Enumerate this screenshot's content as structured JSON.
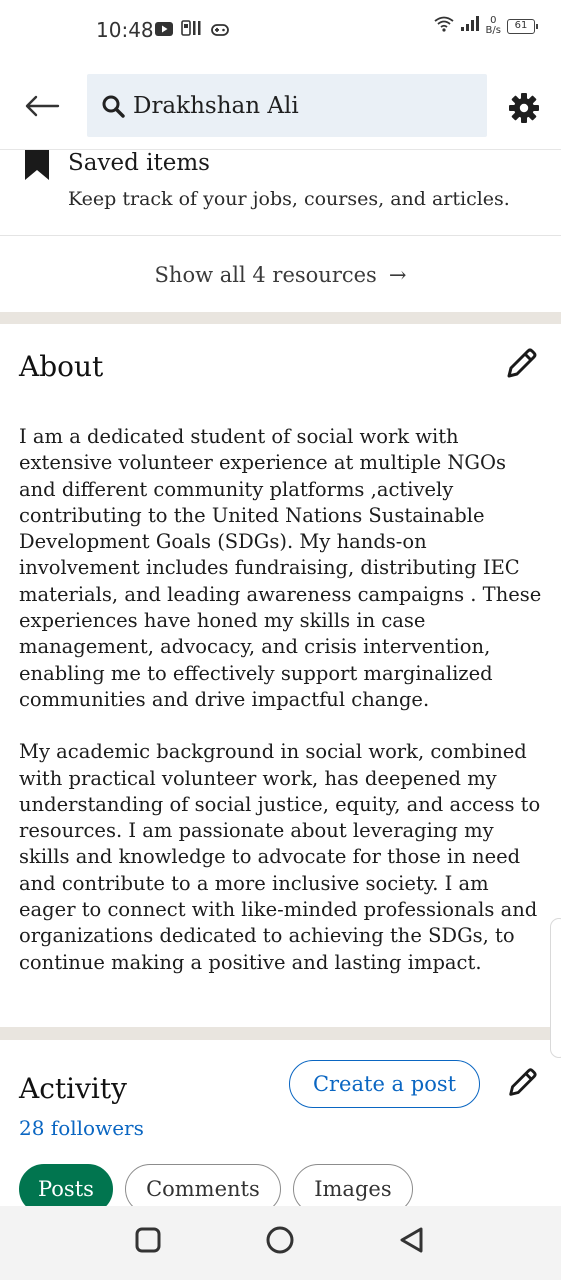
{
  "status_bar": {
    "time": "10:48",
    "net_speed_value": "0",
    "net_speed_unit": "B/s",
    "battery": "61"
  },
  "search": {
    "query": "Drakhshan Ali"
  },
  "saved": {
    "title": "Saved items",
    "description": "Keep track of your jobs, courses, and articles."
  },
  "resources": {
    "show_all_label": "Show all 4 resources",
    "arrow": "→"
  },
  "about": {
    "title": "About",
    "paragraphs": [
      "I am a dedicated student of social work with extensive volunteer experience at multiple NGOs and different community platforms ,actively contributing to the United Nations Sustainable Development Goals (SDGs). My hands-on involvement includes fundraising, distributing IEC materials, and leading awareness campaigns . These experiences have honed my skills in case management, advocacy, and crisis intervention, enabling me to effectively support marginalized communities and drive impactful change.",
      "My academic background in social work, combined with practical volunteer work, has deepened my understanding of social justice, equity, and access to resources. I am passionate about leveraging my skills and knowledge to advocate for those in need and contribute to a more inclusive society. I am eager to connect with like-minded professionals and organizations dedicated to achieving the SDGs, to continue making a positive and lasting impact."
    ]
  },
  "activity": {
    "title": "Activity",
    "followers": "28 followers",
    "create_post_label": "Create a post",
    "tabs": [
      {
        "label": "Posts",
        "active": true
      },
      {
        "label": "Comments",
        "active": false
      },
      {
        "label": "Images",
        "active": false
      }
    ]
  },
  "colors": {
    "link_blue": "#0a66c2",
    "active_tab_green": "#01754f",
    "search_bg": "#eaf0f6",
    "section_divider": "#e9e5df"
  },
  "icons": {
    "back": "arrow-left-icon",
    "search": "search-icon",
    "settings": "gear-icon",
    "bookmark": "bookmark-icon",
    "edit": "pencil-icon",
    "arrow_right": "arrow-right-icon",
    "nav_recents": "square-icon",
    "nav_home": "circle-icon",
    "nav_back": "triangle-back-icon"
  }
}
